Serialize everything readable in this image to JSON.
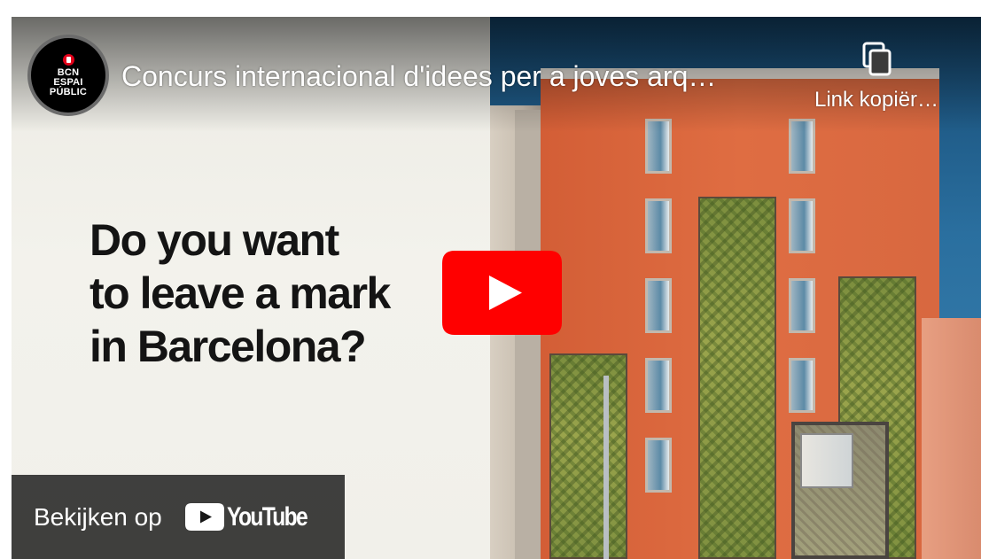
{
  "video": {
    "title": "Concurs internacional d'idees per a joves arq…",
    "headline": {
      "line1": "Do you want",
      "line2": "to leave a mark",
      "line3": "in Barcelona?"
    }
  },
  "channel": {
    "avatar_lines": [
      "BCN",
      "ESPAI",
      "PÚBLIC"
    ]
  },
  "actions": {
    "copy_link_label": "Link kopiër…",
    "watch_on_label": "Bekijken op",
    "youtube_wordmark": "YouTube"
  },
  "icons": {
    "copy": "copy-icon",
    "play": "play-icon",
    "youtube": "youtube-logo-icon",
    "avatar_emblem": "barcelona-emblem-icon"
  },
  "colors": {
    "youtube_red": "#ff0000",
    "overlay_bar": "#171717",
    "headline_text": "#141414",
    "card_background": "#f3f2ec",
    "facade_orange": "#df6d42",
    "sky_blue": "#2a6f9f"
  }
}
